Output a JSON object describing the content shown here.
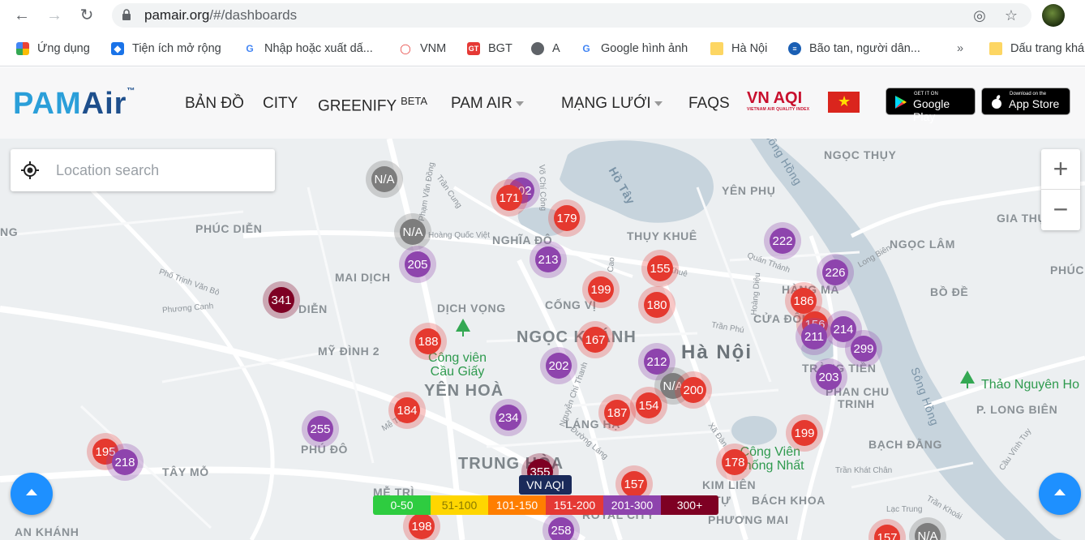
{
  "browser": {
    "url_host": "pamair.org",
    "url_path": "/#/dashboards",
    "bookmarks": [
      {
        "label": "Ứng dụng",
        "icon": "apps-grid-icon"
      },
      {
        "label": "Tiện ích mở rộng",
        "icon": "puzzle-icon"
      },
      {
        "label": "Nhập hoặc xuất dấ...",
        "icon": "google-icon"
      },
      {
        "label": "VNM",
        "icon": "vnm-icon"
      },
      {
        "label": "BGT",
        "icon": "bgt-icon"
      },
      {
        "label": "A",
        "icon": "globe-icon"
      },
      {
        "label": "Google hình ảnh",
        "icon": "google-icon"
      },
      {
        "label": "Hà Nội",
        "icon": "folder-icon"
      },
      {
        "label": "Bão tan, người dân...",
        "icon": "news-icon"
      }
    ],
    "more_bookmarks": "»",
    "other_bookmarks": "Dấu trang khá"
  },
  "header": {
    "logo_pam": "PAM",
    "logo_air": "Air",
    "logo_tm": "™",
    "menu": {
      "map": "BẢN ĐỒ",
      "city": "CITY",
      "greenify": "GREENIFY",
      "greenify_badge": "BETA",
      "pam_air": "PAM AIR",
      "network": "MẠNG LƯỚI",
      "faqs": "FAQS"
    },
    "vn_aqi_logo": "VN AQI",
    "vn_aqi_sub": "VIETNAM AIR QUALITY INDEX",
    "google_play_small": "GET IT ON",
    "google_play": "Google Play",
    "app_store_small": "Download on the",
    "app_store": "App Store"
  },
  "map": {
    "search_placeholder": "Location search",
    "zoom_in": "+",
    "zoom_out": "−",
    "areas": {
      "phuc_dien": "PHÚC DIỄN",
      "mai_dich": "MAI DỊCH",
      "dien": "DIỄN",
      "my_dinh2": "MỸ ĐÌNH 2",
      "dich_vong": "DỊCH VỌNG",
      "yen_hoa": "YÊN HOÀ",
      "phu_do": "PHÚ ĐÔ",
      "tay_mo": "TÂY MỖ",
      "me_tri": "MỄ TRÌ",
      "an_khanh": "AN KHÁNH",
      "trung_hoa": "TRUNG HÒA",
      "nghia_do": "NGHĨA ĐÔ",
      "cong_vi": "CỐNG VỊ",
      "ngoc_khanh": "NGỌC KHÁNH",
      "lang_ha": "LÁNG HẠ",
      "thuy_khue": "THỤY KHUÊ",
      "yen_phu": "YÊN PHỤ",
      "ngoc_thuy": "NGỌC THỤY",
      "gia_thu": "GIA THỤ",
      "ngoc_lam": "NGỌC LÂM",
      "phuc": "PHÚC",
      "bo_de": "BỒ ĐỀ",
      "hang_ma": "HÀNG MÃ",
      "cua_dong": "CỬA ĐÔNG",
      "trang_tien": "TRÀNG TIỀN",
      "phan_chu_trinh_1": "PHAN CHU",
      "phan_chu_trinh_2": "TRINH",
      "p_long_bien": "P. LONG BIÊN",
      "bach_dang": "BẠCH ĐẰNG",
      "kim_lien": "KIM LIÊN",
      "bach_khoa": "BÁCH KHOA",
      "phuong_mai": "PHƯƠNG MAI",
      "royal_city": "ROYAL CITY",
      "tu": "TỰ",
      "ha_noi": "Hà Nội",
      "ng": "NG",
      "ho_tay": "Hồ Tây",
      "song_hong": "Sông Hồng",
      "song_hong_2": "Sông Hồng"
    },
    "streets": {
      "pham_van_dong": "Phạm Văn Đồng",
      "tran_cung": "Trần Cung",
      "vo_chi_cong": "Võ Chí Công",
      "hoang_quoc_viet": "Hoàng Quốc Việt",
      "pho_trinh_van_bo": "Phố Trịnh Văn Bô",
      "phuong_canh": "Phương Canh",
      "quan_thanh": "Quán Thánh",
      "thuy_khue_st": "Thụy Khuê",
      "tran_phu": "Trần Phú",
      "hoang_dieu": "Hoàng Diệu",
      "long_bien": "Long Biên",
      "nguyen_chi_thanh": "Nguyễn Chí Thanh",
      "duong_lang": "Đường Láng",
      "me_tri_st": "Mễ Trì",
      "xa_dan": "Xã Đàn",
      "tran_khat_chan": "Trần Khát Chân",
      "lac_trung": "Lạc Trung",
      "tran_khoai": "Trần Khoái",
      "cau_vinh_tuy": "Cầu Vĩnh Tuy",
      "cao": "Cao"
    },
    "parks": {
      "cau_giay_1": "Công viên",
      "cau_giay_2": "Cầu Giấy",
      "thong_nhat_1": "Công Viên",
      "thong_nhat_2": "Thống Nhất",
      "thao_nguyen": "Thảo Nguyên Ho"
    },
    "legend_title": "VN AQI",
    "legend": [
      {
        "label": "0-50",
        "color": "#2ecc40"
      },
      {
        "label": "51-100",
        "color": "#ffd600"
      },
      {
        "label": "101-150",
        "color": "#ff7e00"
      },
      {
        "label": "151-200",
        "color": "#e53935"
      },
      {
        "label": "201-300",
        "color": "#8e44ad"
      },
      {
        "label": "300+",
        "color": "#7e0023"
      }
    ],
    "stations": [
      {
        "aqi": "N/A",
        "level": "gray"
      },
      {
        "aqi": "202",
        "level": "purple"
      },
      {
        "aqi": "171",
        "level": "red"
      },
      {
        "aqi": "179",
        "level": "red"
      },
      {
        "aqi": "N/A",
        "level": "gray"
      },
      {
        "aqi": "205",
        "level": "purple"
      },
      {
        "aqi": "213",
        "level": "purple"
      },
      {
        "aqi": "155",
        "level": "red"
      },
      {
        "aqi": "199",
        "level": "red"
      },
      {
        "aqi": "180",
        "level": "red"
      },
      {
        "aqi": "341",
        "level": "maroon"
      },
      {
        "aqi": "188",
        "level": "red"
      },
      {
        "aqi": "167",
        "level": "red"
      },
      {
        "aqi": "202",
        "level": "purple"
      },
      {
        "aqi": "212",
        "level": "purple"
      },
      {
        "aqi": "N/A",
        "level": "gray"
      },
      {
        "aqi": "200",
        "level": "red"
      },
      {
        "aqi": "184",
        "level": "red"
      },
      {
        "aqi": "234",
        "level": "purple"
      },
      {
        "aqi": "187",
        "level": "red"
      },
      {
        "aqi": "154",
        "level": "red"
      },
      {
        "aqi": "255",
        "level": "purple"
      },
      {
        "aqi": "195",
        "level": "red"
      },
      {
        "aqi": "218",
        "level": "purple"
      },
      {
        "aqi": "355",
        "level": "maroon"
      },
      {
        "aqi": "157",
        "level": "red"
      },
      {
        "aqi": "198",
        "level": "red"
      },
      {
        "aqi": "258",
        "level": "purple"
      },
      {
        "aqi": "222",
        "level": "purple"
      },
      {
        "aqi": "226",
        "level": "purple"
      },
      {
        "aqi": "186",
        "level": "red"
      },
      {
        "aqi": "156",
        "level": "red"
      },
      {
        "aqi": "211",
        "level": "purple"
      },
      {
        "aqi": "214",
        "level": "purple"
      },
      {
        "aqi": "299",
        "level": "purple"
      },
      {
        "aqi": "203",
        "level": "purple"
      },
      {
        "aqi": "199",
        "level": "red"
      },
      {
        "aqi": "178",
        "level": "red"
      },
      {
        "aqi": "157",
        "level": "red"
      },
      {
        "aqi": "N/A",
        "level": "gray"
      }
    ]
  }
}
